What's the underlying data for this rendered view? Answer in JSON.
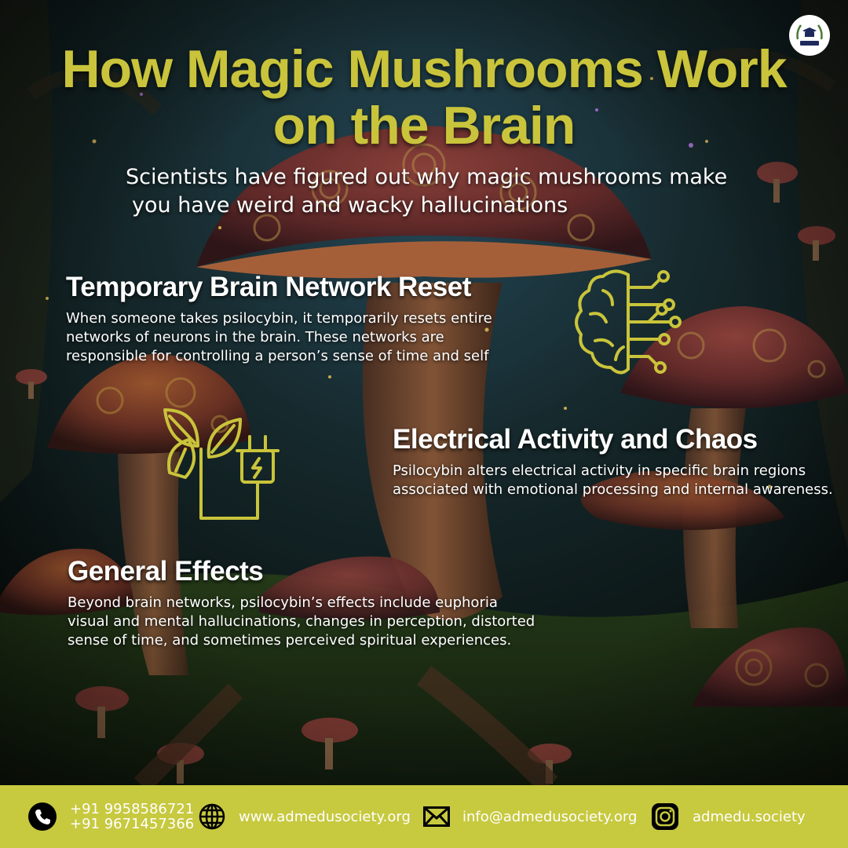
{
  "header": {
    "title_line1": "How Magic Mushrooms Work",
    "title_line2": "on the Brain",
    "subtitle_line1": "Scientists have figured out why magic mushrooms make",
    "subtitle_line2": "you have weird and wacky hallucinations"
  },
  "sections": [
    {
      "heading": "Temporary Brain Network Reset",
      "body": "When someone takes psilocybin, it temporarily resets entire networks of neurons in the brain. These networks are responsible for controlling a person’s sense of time and self",
      "icon": "brain-circuit-icon"
    },
    {
      "heading": "Electrical Activity and Chaos",
      "body": "Psilocybin alters electrical activity in specific brain regions associated with emotional processing and internal awareness.",
      "icon": "leaf-plug-icon"
    },
    {
      "heading": "General Effects",
      "body": "Beyond brain networks, psilocybin’s effects include euphoria visual and mental hallucinations, changes in perception, distorted sense of time, and sometimes perceived spiritual experiences."
    }
  ],
  "footer": {
    "phone1": "+91 9958586721",
    "phone2": "+91 9671457366",
    "website": "www.admedusociety.org",
    "email": "info@admedusociety.org",
    "instagram": "admedu.society"
  },
  "colors": {
    "accent": "#c9c43b",
    "footer_bg": "#c7c93f",
    "text": "#ffffff"
  },
  "icons": [
    "logo-emblem",
    "phone-icon",
    "globe-icon",
    "mail-icon",
    "instagram-icon",
    "brain-circuit-icon",
    "leaf-plug-icon"
  ]
}
